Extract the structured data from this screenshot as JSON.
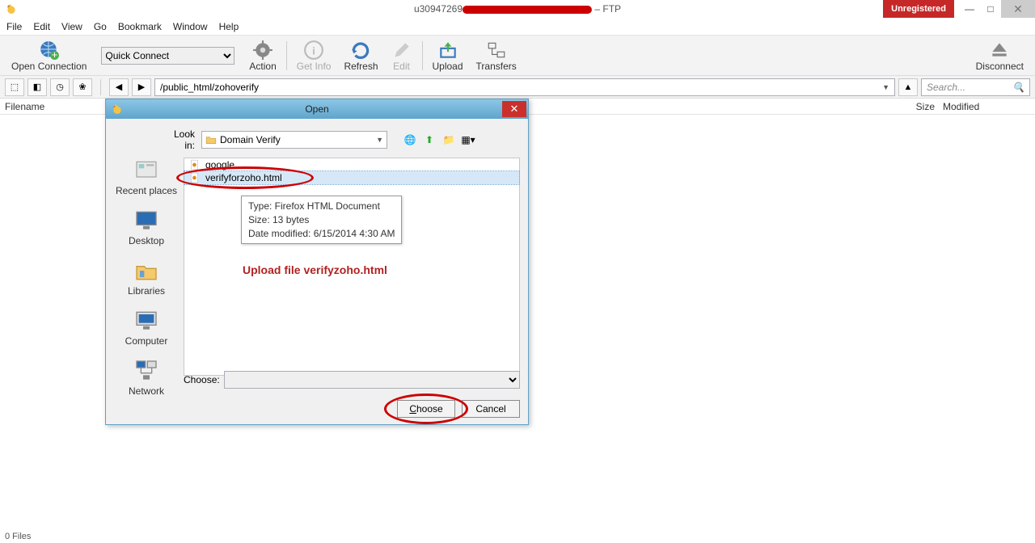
{
  "titlebar": {
    "user_prefix": "u30947269",
    "suffix": " – FTP",
    "unregistered": "Unregistered"
  },
  "menu": {
    "file": "File",
    "edit": "Edit",
    "view": "View",
    "go": "Go",
    "bookmark": "Bookmark",
    "window": "Window",
    "help": "Help"
  },
  "toolbar": {
    "open_connection": "Open Connection",
    "quick_connect": "Quick Connect",
    "action": "Action",
    "get_info": "Get Info",
    "refresh": "Refresh",
    "edit": "Edit",
    "upload": "Upload",
    "transfers": "Transfers",
    "disconnect": "Disconnect"
  },
  "pathbar": {
    "path": "/public_html/zohoverify",
    "search_placeholder": "Search..."
  },
  "columns": {
    "filename": "Filename",
    "size": "Size",
    "modified": "Modified"
  },
  "dialog": {
    "title": "Open",
    "look_in_label": "Look in:",
    "look_in_value": "Domain Verify",
    "files": [
      {
        "name": "google...",
        "partial": true
      },
      {
        "name": "verifyforzoho.html"
      }
    ],
    "tooltip": {
      "line1": "Type: Firefox HTML Document",
      "line2": "Size: 13 bytes",
      "line3": "Date modified: 6/15/2014 4:30 AM"
    },
    "annotation": "Upload file verifyzoho.html",
    "choose_label": "Choose:",
    "places": {
      "recent": "Recent places",
      "desktop": "Desktop",
      "libraries": "Libraries",
      "computer": "Computer",
      "network": "Network"
    },
    "buttons": {
      "choose": "Choose",
      "cancel": "Cancel"
    }
  },
  "status": {
    "files": "0 Files"
  }
}
